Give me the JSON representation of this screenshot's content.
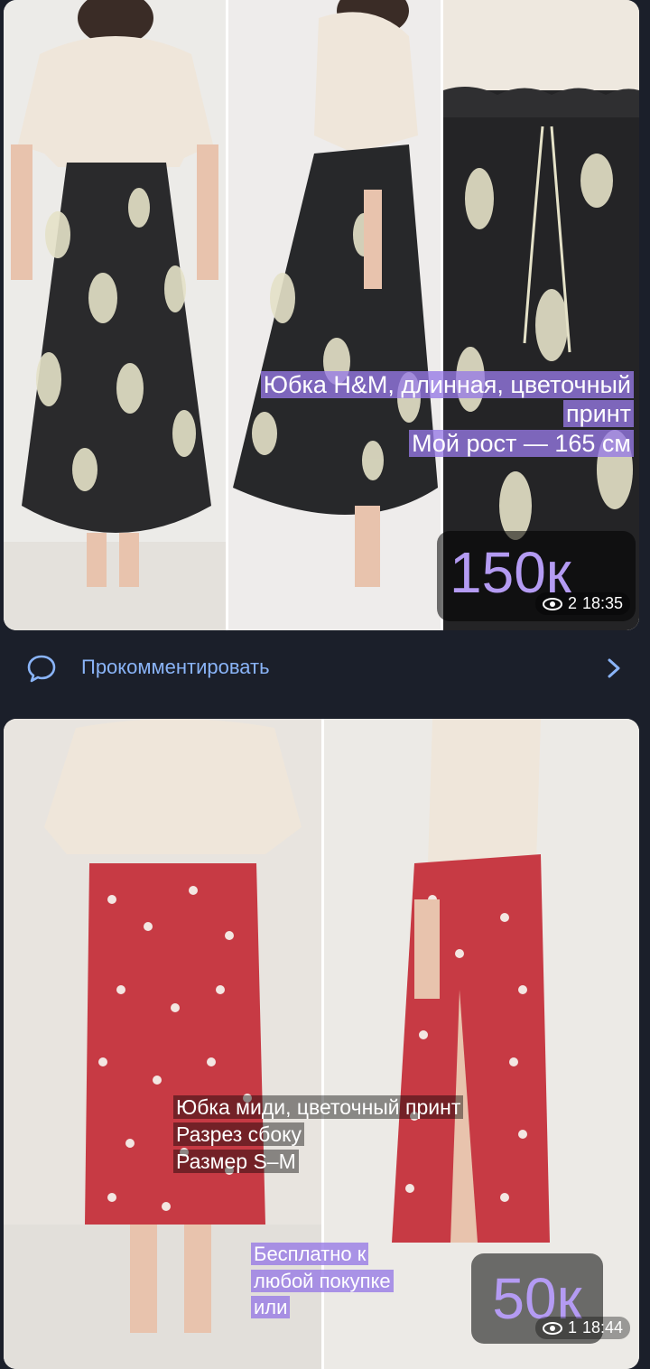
{
  "post1": {
    "caption_lines": [
      "Юбка H&M, длинная, цветочный",
      "принт",
      "Мой рост — 165 см"
    ],
    "price": "150к",
    "views": "2",
    "time": "18:35"
  },
  "comment_bar": {
    "label": "Прокомментировать",
    "icon": "chat-bubble-icon",
    "chevron": "chevron-right-icon"
  },
  "post2": {
    "caption_lines": [
      "Юбка миди, цветочный принт",
      "Разрез сбоку",
      "Размер S–M"
    ],
    "promo_lines": [
      "Бесплатно к",
      "любой покупке",
      "или"
    ],
    "price": "50к",
    "views": "1",
    "time": "18:44"
  },
  "colors": {
    "background": "#1b1f2a",
    "accent": "#8ab4f8",
    "price_text": "#b49bf3",
    "promo_bg": "#9678e6"
  }
}
